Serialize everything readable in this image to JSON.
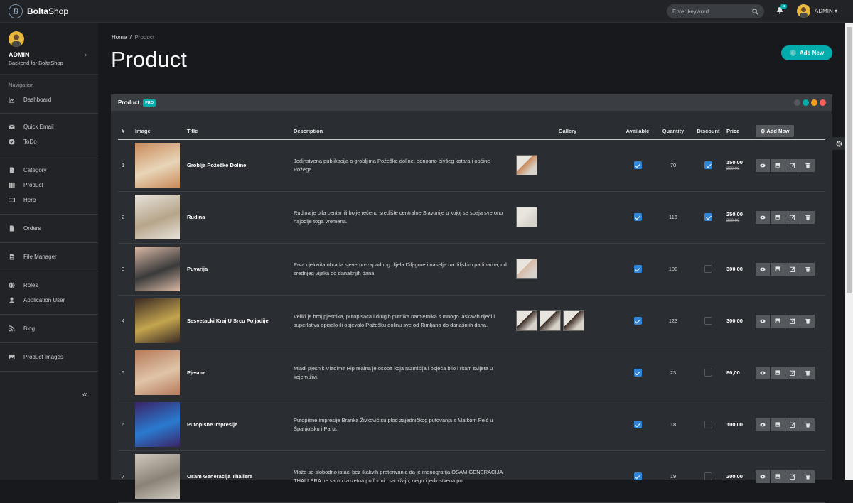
{
  "topbar": {
    "brand_bold": "Bolta",
    "brand_rest": "Shop",
    "search_placeholder": "Enter keyword",
    "notification_count": "5",
    "user_label": "ADMIN"
  },
  "sidebar": {
    "profile_name": "ADMIN",
    "profile_sub": "Backend for BoltaShop",
    "nav_heading": "Navigation",
    "groups": [
      [
        {
          "label": "Dashboard",
          "icon": "chart-icon"
        }
      ],
      [
        {
          "label": "Quick Email",
          "icon": "envelope-icon"
        },
        {
          "label": "ToDo",
          "icon": "check-circle-icon"
        }
      ],
      [
        {
          "label": "Category",
          "icon": "file-icon"
        },
        {
          "label": "Product",
          "icon": "columns-icon"
        },
        {
          "label": "Hero",
          "icon": "ticket-icon"
        }
      ],
      [
        {
          "label": "Orders",
          "icon": "file-icon"
        }
      ],
      [
        {
          "label": "File Manager",
          "icon": "file-lines-icon"
        }
      ],
      [
        {
          "label": "Roles",
          "icon": "globe-icon"
        },
        {
          "label": "Application User",
          "icon": "user-icon"
        }
      ],
      [
        {
          "label": "Blog",
          "icon": "blog-icon"
        }
      ],
      [
        {
          "label": "Product Images",
          "icon": "image-icon"
        }
      ]
    ]
  },
  "breadcrumb": {
    "home": "Home",
    "current": "Product"
  },
  "page_title": "Product",
  "add_new_top": "Add New",
  "panel": {
    "title": "Product",
    "badge": "PRO",
    "add_new": "Add New"
  },
  "table": {
    "headers": {
      "num": "#",
      "image": "Image",
      "title": "Title",
      "description": "Description",
      "gallery": "Gallery",
      "available": "Available",
      "quantity": "Quantity",
      "discount": "Discount",
      "price": "Price"
    },
    "rows": [
      {
        "num": "1",
        "title": "Groblja Požeške Doline",
        "description": "Jedinstvena publikacija o grobljima Požeške doline, odnosno bivšeg kotara i općine Požega.",
        "gallery": 1,
        "available": true,
        "quantity": "70",
        "discount": true,
        "price": "150,00",
        "old_price": "200,00"
      },
      {
        "num": "2",
        "title": "Rudina",
        "description": "Rudina je bila centar ili bolje rečeno središte centralne Slavonije u kojoj se spaja sve ono najbolje toga vremena.",
        "gallery": 1,
        "available": true,
        "quantity": "116",
        "discount": true,
        "price": "250,00",
        "old_price": "300,00"
      },
      {
        "num": "3",
        "title": "Puvarija",
        "description": "Prva cjelovita obrada sjeverno-zapadnog dijela Dilj-gore i naselja na diljskim padinama, od srednjeg vijeka do današnjih dana.",
        "gallery": 1,
        "available": true,
        "quantity": "100",
        "discount": false,
        "price": "300,00",
        "old_price": ""
      },
      {
        "num": "4",
        "title": "Sesvetacki Kraj U Srcu Poljadije",
        "description": "Veliki je broj pjesnika, putopisaca i drugih putnika namjernika s mnogo laskavih riječi i superlativa opisalo ili opjevalo Požešku dolinu sve od Rimljana do današnjih dana.",
        "gallery": 3,
        "available": true,
        "quantity": "123",
        "discount": false,
        "price": "300,00",
        "old_price": ""
      },
      {
        "num": "5",
        "title": "Pjesme",
        "description": "Mladi pjesnik Vladimir Hip realna je osoba koja razmišlja i osjeća bilo i ritam svijeta u kojem živi.",
        "gallery": 0,
        "available": true,
        "quantity": "23",
        "discount": false,
        "price": "80,00",
        "old_price": ""
      },
      {
        "num": "6",
        "title": "Putopisne Impresije",
        "description": "Putopisne impresije Branka Živković su plod zajedničkog putovanja s Matkom Peić u Španjolsku i Pariz.",
        "gallery": 0,
        "available": true,
        "quantity": "18",
        "discount": false,
        "price": "100,00",
        "old_price": ""
      },
      {
        "num": "7",
        "title": "Osam Generacija Thallera",
        "description": "Može se slobodno istaći bez ikakvih preterivanja da je monografija OSAM GENERACIJA THALLERA ne samo izuzetna po formi i sadržaju, nego i jedinstvena po",
        "gallery": 0,
        "available": true,
        "quantity": "19",
        "discount": false,
        "price": "200,00",
        "old_price": ""
      }
    ]
  },
  "colors": {
    "accent": "#00acac",
    "checkbox": "#2f85d8"
  }
}
